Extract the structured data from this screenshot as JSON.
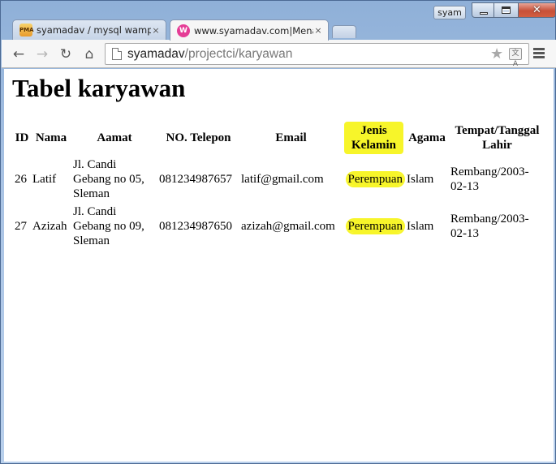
{
  "window": {
    "user_badge": "syam",
    "close_glyph": "✕"
  },
  "tabs": [
    {
      "title": "syamadav / mysql wampse",
      "favicon_text": "PMA",
      "close": "×"
    },
    {
      "title": "www.syamadav.com|Mena",
      "favicon_text": "W",
      "close": "×"
    }
  ],
  "toolbar": {
    "back_glyph": "←",
    "forward_glyph": "→",
    "reload_glyph": "↻",
    "home_glyph": "⌂",
    "url_host": "syamadav",
    "url_path": "/projectci/karyawan",
    "star_glyph": "★",
    "translate_glyph": "文A",
    "icons": [
      "back-icon",
      "forward-icon",
      "reload-icon",
      "home-icon",
      "page-icon",
      "star-icon",
      "translate-icon",
      "menu-icon"
    ]
  },
  "page": {
    "heading": "Tabel karyawan",
    "highlight_color": "#f7f52a",
    "table": {
      "headers": [
        "ID",
        "Nama",
        "Aamat",
        "NO. Telepon",
        "Email",
        "Jenis Kelamin",
        "Agama",
        "Tempat/Tanggal Lahir"
      ],
      "rows": [
        {
          "id": "26",
          "nama": "Latif",
          "alamat": "Jl. Candi Gebang no 05, Sleman",
          "telepon": "081234987657",
          "email": "latif@gmail.com",
          "jenis_kelamin": "Perempuan",
          "agama": "Islam",
          "ttl": "Rembang/2003-02-13"
        },
        {
          "id": "27",
          "nama": "Azizah",
          "alamat": "Jl. Candi Gebang no 09, Sleman",
          "telepon": "081234987650",
          "email": "azizah@gmail.com",
          "jenis_kelamin": "Perempuan",
          "agama": "Islam",
          "ttl": "Rembang/2003-02-13"
        }
      ]
    }
  }
}
